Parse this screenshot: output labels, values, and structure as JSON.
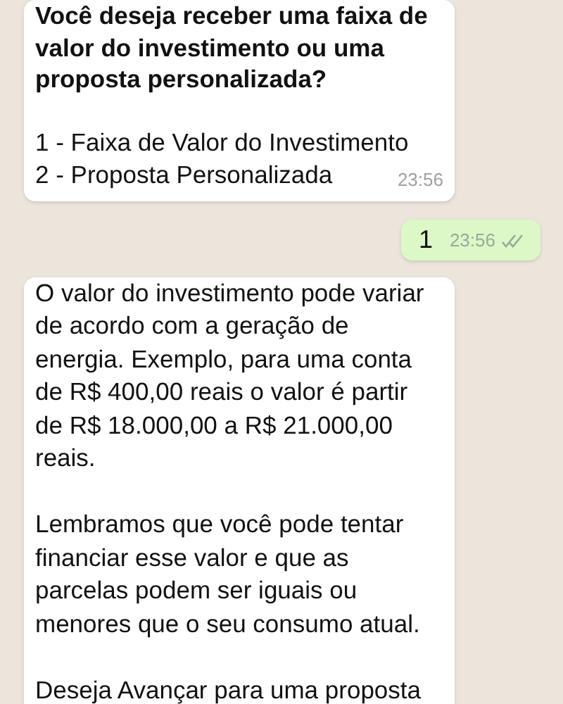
{
  "messages": [
    {
      "kind": "incoming",
      "heading": "Você deseja receber uma faixa de\nvalor do investimento ou uma\nproposta personalizada?",
      "options": [
        "1 - Faixa de Valor do Investimento",
        "2 - Proposta Personalizada"
      ],
      "time": "23:56"
    },
    {
      "kind": "outgoing",
      "body": "1",
      "time": "23:56",
      "read": false
    },
    {
      "kind": "incoming",
      "body": "O valor do investimento pode variar\nde acordo com a geração de\nenergia. Exemplo, para uma conta\nde R$ 400,00 reais o valor é partir\nde R$ 18.000,00 a R$ 21.000,00\nreais.\n\nLembramos que você pode tentar\nfinanciar esse valor e que as\nparcelas podem ser iguais ou\nmenores que o seu consumo atual.\n\nDeseja Avançar para uma proposta"
    }
  ]
}
